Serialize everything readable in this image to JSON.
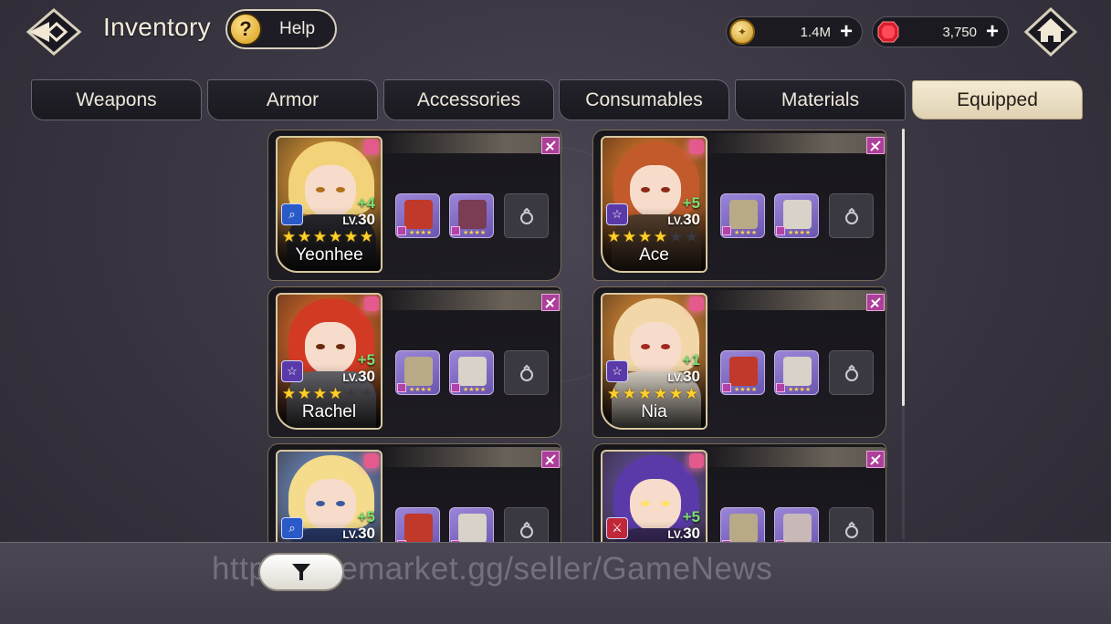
{
  "header": {
    "title": "Inventory",
    "help_label": "Help",
    "help_glyph": "?",
    "gold": "1.4M",
    "gems": "3,750",
    "plus_glyph": "+"
  },
  "tabs": [
    {
      "label": "Weapons",
      "active": false
    },
    {
      "label": "Armor",
      "active": false
    },
    {
      "label": "Accessories",
      "active": false
    },
    {
      "label": "Consumables",
      "active": false
    },
    {
      "label": "Materials",
      "active": false
    },
    {
      "label": "Equipped",
      "active": true
    }
  ],
  "lv_prefix": "LV.",
  "heroes": [
    {
      "name": "Yeonhee",
      "plus": "+4",
      "level": "30",
      "stars": 6,
      "class_icon": "search-icon",
      "hair": "#f2d37a",
      "accent": "#ef9b3d",
      "bg": "#ffb23d",
      "eyes": "#b0701c",
      "body": "#2a2a30",
      "slot1": "#c0392b",
      "slot2": "#7a3d55"
    },
    {
      "name": "Ace",
      "plus": "+5",
      "level": "30",
      "stars": 4,
      "class_icon": "star-icon",
      "hair": "#c25a2c",
      "accent": "#e2763a",
      "bg": "#ff8a2a",
      "eyes": "#8a2a15",
      "body": "#5a4330",
      "slot1": "#b8aa86",
      "slot2": "#d8d2c8"
    },
    {
      "name": "Rachel",
      "plus": "+5",
      "level": "30",
      "stars": 4,
      "class_icon": "star-icon",
      "hair": "#d23a24",
      "accent": "#ffffff",
      "bg": "#ff7a2a",
      "eyes": "#6a2a10",
      "body": "#6a6a70",
      "slot1": "#b8aa86",
      "slot2": "#d8d2c8"
    },
    {
      "name": "Nia",
      "plus": "+1",
      "level": "30",
      "stars": 6,
      "class_icon": "star-icon",
      "hair": "#f2d8a8",
      "accent": "#e39a3a",
      "bg": "#ffa23a",
      "eyes": "#a02a20",
      "body": "#e6ddd0",
      "slot1": "#c0392b",
      "slot2": "#d8d2c8"
    },
    {
      "name": "",
      "plus": "+5",
      "level": "30",
      "stars": 0,
      "class_icon": "search-icon",
      "hair": "#f4dc8c",
      "accent": "#6a8ad8",
      "bg": "#7aa4e8",
      "eyes": "#3a5aa0",
      "body": "#2a3a6a",
      "slot1": "#c0392b",
      "slot2": "#d8d2c8"
    },
    {
      "name": "",
      "plus": "+5",
      "level": "30",
      "stars": 0,
      "class_icon": "sword-icon",
      "hair": "#5a3aa8",
      "accent": "#2a2a3a",
      "bg": "#6a5ab8",
      "eyes": "#ffe070",
      "body": "#3a2a5a",
      "slot1": "#b8aa86",
      "slot2": "#c8b8b8"
    }
  ],
  "watermark": "http   gamemarket.gg/seller/GameNews",
  "colors": {
    "active_tab": "#efe3c6",
    "level_plus": "#7ce072",
    "star": "#ffcf2a",
    "unequip": "#ad3f9a"
  }
}
